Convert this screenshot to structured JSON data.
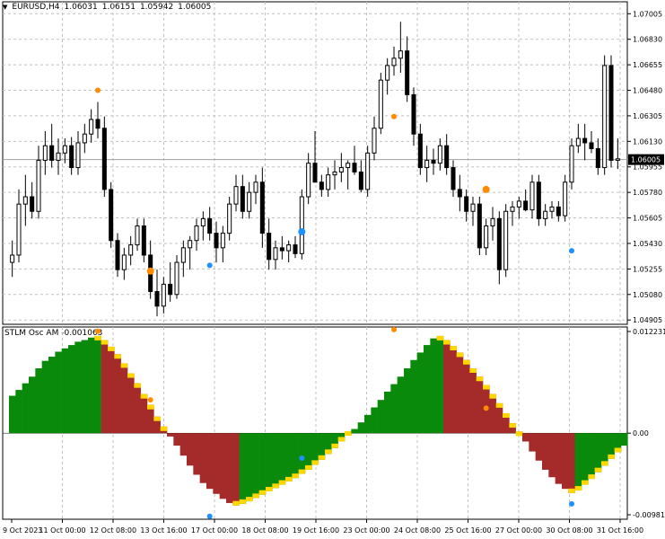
{
  "main_chart": {
    "symbol": "EURUSD,H4",
    "ohlc": [
      "1.06031",
      "1.06151",
      "1.05942",
      "1.06005"
    ],
    "price_labels": [
      "1.07005",
      "1.06830",
      "1.06655",
      "1.06480",
      "1.06305",
      "1.06130",
      "1.05955",
      "1.05780",
      "1.05605",
      "1.05430",
      "1.05255",
      "1.05080",
      "1.04905"
    ],
    "current_price_label": "1.06005"
  },
  "oscillator": {
    "title": "STLM Osc AM -0.001063",
    "labels": [
      "0.012231",
      "0.00",
      "-0.009811"
    ]
  },
  "time_labels": [
    "9 Oct 2023",
    "11 Oct 00:00",
    "12 Oct 08:00",
    "13 Oct 16:00",
    "17 Oct 00:00",
    "18 Oct 08:00",
    "19 Oct 16:00",
    "23 Oct 00:00",
    "24 Oct 08:00",
    "25 Oct 16:00",
    "27 Oct 00:00",
    "30 Oct 08:00",
    "31 Oct 16:00"
  ],
  "colors": {
    "bull_bar": "#0a8a0a",
    "bear_bar": "#a52a2a",
    "signal_bar": "#ffd700",
    "dot_orange": "#ff8c00",
    "dot_blue": "#1e90ff",
    "grid": "#c0c0c0"
  },
  "chart_data": [
    {
      "type": "candlestick",
      "title": "EURUSD,H4",
      "ylim": [
        1.049,
        1.0705
      ],
      "candles": [
        {
          "o": 1.053,
          "h": 1.0545,
          "l": 1.052,
          "c": 1.0535
        },
        {
          "o": 1.0535,
          "h": 1.058,
          "l": 1.053,
          "c": 1.057
        },
        {
          "o": 1.057,
          "h": 1.059,
          "l": 1.0555,
          "c": 1.0575
        },
        {
          "o": 1.0575,
          "h": 1.0585,
          "l": 1.056,
          "c": 1.0565
        },
        {
          "o": 1.0565,
          "h": 1.061,
          "l": 1.056,
          "c": 1.06
        },
        {
          "o": 1.06,
          "h": 1.062,
          "l": 1.059,
          "c": 1.061
        },
        {
          "o": 1.061,
          "h": 1.0625,
          "l": 1.0595,
          "c": 1.06
        },
        {
          "o": 1.06,
          "h": 1.0615,
          "l": 1.059,
          "c": 1.0605
        },
        {
          "o": 1.0605,
          "h": 1.0615,
          "l": 1.0598,
          "c": 1.061
        },
        {
          "o": 1.061,
          "h": 1.0616,
          "l": 1.059,
          "c": 1.0595
        },
        {
          "o": 1.0595,
          "h": 1.062,
          "l": 1.059,
          "c": 1.0612
        },
        {
          "o": 1.0612,
          "h": 1.0625,
          "l": 1.0605,
          "c": 1.0618
        },
        {
          "o": 1.0618,
          "h": 1.0635,
          "l": 1.0612,
          "c": 1.0628
        },
        {
          "o": 1.0628,
          "h": 1.064,
          "l": 1.0615,
          "c": 1.0622
        },
        {
          "o": 1.0622,
          "h": 1.063,
          "l": 1.0575,
          "c": 1.058
        },
        {
          "o": 1.058,
          "h": 1.0585,
          "l": 1.054,
          "c": 1.0545
        },
        {
          "o": 1.0545,
          "h": 1.055,
          "l": 1.052,
          "c": 1.0525
        },
        {
          "o": 1.0525,
          "h": 1.054,
          "l": 1.0518,
          "c": 1.0535
        },
        {
          "o": 1.0535,
          "h": 1.0548,
          "l": 1.0528,
          "c": 1.0542
        },
        {
          "o": 1.0542,
          "h": 1.056,
          "l": 1.0538,
          "c": 1.0555
        },
        {
          "o": 1.0555,
          "h": 1.056,
          "l": 1.053,
          "c": 1.0535
        },
        {
          "o": 1.0535,
          "h": 1.0545,
          "l": 1.0505,
          "c": 1.051
        },
        {
          "o": 1.051,
          "h": 1.0525,
          "l": 1.0493,
          "c": 1.05
        },
        {
          "o": 1.05,
          "h": 1.052,
          "l": 1.0495,
          "c": 1.0515
        },
        {
          "o": 1.0515,
          "h": 1.053,
          "l": 1.0503,
          "c": 1.0508
        },
        {
          "o": 1.0508,
          "h": 1.0535,
          "l": 1.0505,
          "c": 1.053
        },
        {
          "o": 1.053,
          "h": 1.0545,
          "l": 1.052,
          "c": 1.054
        },
        {
          "o": 1.054,
          "h": 1.0548,
          "l": 1.0525,
          "c": 1.0545
        },
        {
          "o": 1.0545,
          "h": 1.056,
          "l": 1.0538,
          "c": 1.0555
        },
        {
          "o": 1.0555,
          "h": 1.0565,
          "l": 1.0545,
          "c": 1.056
        },
        {
          "o": 1.056,
          "h": 1.0568,
          "l": 1.0545,
          "c": 1.055
        },
        {
          "o": 1.055,
          "h": 1.0558,
          "l": 1.053,
          "c": 1.054
        },
        {
          "o": 1.054,
          "h": 1.0555,
          "l": 1.053,
          "c": 1.055
        },
        {
          "o": 1.055,
          "h": 1.0575,
          "l": 1.0545,
          "c": 1.057
        },
        {
          "o": 1.057,
          "h": 1.059,
          "l": 1.0565,
          "c": 1.0582
        },
        {
          "o": 1.0582,
          "h": 1.059,
          "l": 1.056,
          "c": 1.0565
        },
        {
          "o": 1.0565,
          "h": 1.0585,
          "l": 1.056,
          "c": 1.0578
        },
        {
          "o": 1.0578,
          "h": 1.059,
          "l": 1.057,
          "c": 1.0585
        },
        {
          "o": 1.0585,
          "h": 1.0595,
          "l": 1.054,
          "c": 1.055
        },
        {
          "o": 1.055,
          "h": 1.056,
          "l": 1.0525,
          "c": 1.0532
        },
        {
          "o": 1.0532,
          "h": 1.0545,
          "l": 1.0525,
          "c": 1.054
        },
        {
          "o": 1.054,
          "h": 1.0548,
          "l": 1.0532,
          "c": 1.0538
        },
        {
          "o": 1.0538,
          "h": 1.0545,
          "l": 1.053,
          "c": 1.0542
        },
        {
          "o": 1.0542,
          "h": 1.0548,
          "l": 1.0533,
          "c": 1.0536
        },
        {
          "o": 1.0536,
          "h": 1.058,
          "l": 1.0532,
          "c": 1.0575
        },
        {
          "o": 1.0575,
          "h": 1.0605,
          "l": 1.057,
          "c": 1.0598
        },
        {
          "o": 1.0598,
          "h": 1.062,
          "l": 1.059,
          "c": 1.0585
        },
        {
          "o": 1.0585,
          "h": 1.059,
          "l": 1.0575,
          "c": 1.058
        },
        {
          "o": 1.058,
          "h": 1.0595,
          "l": 1.0575,
          "c": 1.059
        },
        {
          "o": 1.059,
          "h": 1.06,
          "l": 1.058,
          "c": 1.0592
        },
        {
          "o": 1.0592,
          "h": 1.0605,
          "l": 1.0585,
          "c": 1.0595
        },
        {
          "o": 1.0595,
          "h": 1.06,
          "l": 1.058,
          "c": 1.0598
        },
        {
          "o": 1.0598,
          "h": 1.061,
          "l": 1.059,
          "c": 1.0592
        },
        {
          "o": 1.0592,
          "h": 1.06,
          "l": 1.0578,
          "c": 1.058
        },
        {
          "o": 1.058,
          "h": 1.061,
          "l": 1.0575,
          "c": 1.0605
        },
        {
          "o": 1.0605,
          "h": 1.063,
          "l": 1.06,
          "c": 1.0622
        },
        {
          "o": 1.0622,
          "h": 1.066,
          "l": 1.0618,
          "c": 1.0655
        },
        {
          "o": 1.0655,
          "h": 1.067,
          "l": 1.0645,
          "c": 1.0665
        },
        {
          "o": 1.0665,
          "h": 1.0678,
          "l": 1.0658,
          "c": 1.067
        },
        {
          "o": 1.067,
          "h": 1.0695,
          "l": 1.066,
          "c": 1.0675
        },
        {
          "o": 1.0675,
          "h": 1.0685,
          "l": 1.064,
          "c": 1.0645
        },
        {
          "o": 1.0645,
          "h": 1.065,
          "l": 1.061,
          "c": 1.0618
        },
        {
          "o": 1.0618,
          "h": 1.0625,
          "l": 1.059,
          "c": 1.0595
        },
        {
          "o": 1.0595,
          "h": 1.061,
          "l": 1.0585,
          "c": 1.06
        },
        {
          "o": 1.06,
          "h": 1.0608,
          "l": 1.059,
          "c": 1.0598
        },
        {
          "o": 1.0598,
          "h": 1.0615,
          "l": 1.0593,
          "c": 1.061
        },
        {
          "o": 1.061,
          "h": 1.0618,
          "l": 1.059,
          "c": 1.0595
        },
        {
          "o": 1.0595,
          "h": 1.06,
          "l": 1.0575,
          "c": 1.058
        },
        {
          "o": 1.058,
          "h": 1.059,
          "l": 1.0565,
          "c": 1.0575
        },
        {
          "o": 1.0575,
          "h": 1.058,
          "l": 1.0558,
          "c": 1.0565
        },
        {
          "o": 1.0565,
          "h": 1.0575,
          "l": 1.0555,
          "c": 1.057
        },
        {
          "o": 1.057,
          "h": 1.0575,
          "l": 1.0535,
          "c": 1.054
        },
        {
          "o": 1.054,
          "h": 1.056,
          "l": 1.0535,
          "c": 1.0555
        },
        {
          "o": 1.0555,
          "h": 1.0568,
          "l": 1.0545,
          "c": 1.056
        },
        {
          "o": 1.056,
          "h": 1.0565,
          "l": 1.0515,
          "c": 1.0525
        },
        {
          "o": 1.0525,
          "h": 1.057,
          "l": 1.052,
          "c": 1.0565
        },
        {
          "o": 1.0565,
          "h": 1.0572,
          "l": 1.0555,
          "c": 1.0568
        },
        {
          "o": 1.0568,
          "h": 1.0575,
          "l": 1.056,
          "c": 1.0572
        },
        {
          "o": 1.0572,
          "h": 1.058,
          "l": 1.0565,
          "c": 1.0566
        },
        {
          "o": 1.0566,
          "h": 1.059,
          "l": 1.056,
          "c": 1.0585
        },
        {
          "o": 1.0585,
          "h": 1.059,
          "l": 1.0555,
          "c": 1.056
        },
        {
          "o": 1.056,
          "h": 1.057,
          "l": 1.0555,
          "c": 1.0565
        },
        {
          "o": 1.0565,
          "h": 1.0572,
          "l": 1.056,
          "c": 1.0568
        },
        {
          "o": 1.0568,
          "h": 1.0572,
          "l": 1.0558,
          "c": 1.0562
        },
        {
          "o": 1.0562,
          "h": 1.059,
          "l": 1.0558,
          "c": 1.0585
        },
        {
          "o": 1.0585,
          "h": 1.0615,
          "l": 1.058,
          "c": 1.061
        },
        {
          "o": 1.061,
          "h": 1.0625,
          "l": 1.0605,
          "c": 1.0615
        },
        {
          "o": 1.0615,
          "h": 1.0625,
          "l": 1.06,
          "c": 1.0612
        },
        {
          "o": 1.0612,
          "h": 1.062,
          "l": 1.0605,
          "c": 1.0608
        },
        {
          "o": 1.0608,
          "h": 1.0615,
          "l": 1.059,
          "c": 1.0595
        },
        {
          "o": 1.0595,
          "h": 1.0672,
          "l": 1.059,
          "c": 1.0665
        },
        {
          "o": 1.0665,
          "h": 1.0672,
          "l": 1.0595,
          "c": 1.06
        },
        {
          "o": 1.06,
          "h": 1.0615,
          "l": 1.0594,
          "c": 1.0601
        }
      ]
    },
    {
      "type": "bar",
      "title": "STLM Osc AM -0.001063",
      "ylim": [
        -0.009811,
        0.012231
      ],
      "values": [
        0.0045,
        0.0052,
        0.006,
        0.0068,
        0.0078,
        0.0087,
        0.0092,
        0.0098,
        0.0102,
        0.0106,
        0.011,
        0.0112,
        0.0115,
        0.0117,
        0.0112,
        0.0104,
        0.0095,
        0.0084,
        0.0072,
        0.006,
        0.0047,
        0.0034,
        0.002,
        0.0008,
        -0.0004,
        -0.0015,
        -0.0027,
        -0.0039,
        -0.005,
        -0.006,
        -0.0067,
        -0.0073,
        -0.0079,
        -0.0084,
        -0.0087,
        -0.0085,
        -0.0082,
        -0.0078,
        -0.0074,
        -0.007,
        -0.0066,
        -0.0062,
        -0.0058,
        -0.0054,
        -0.0049,
        -0.0044,
        -0.0038,
        -0.0032,
        -0.0025,
        -0.0018,
        -0.001,
        -0.0003,
        0.0005,
        0.0013,
        0.0022,
        0.0031,
        0.004,
        0.005,
        0.0059,
        0.0068,
        0.0078,
        0.0088,
        0.0097,
        0.0106,
        0.0114,
        0.0117,
        0.0112,
        0.0105,
        0.0097,
        0.0088,
        0.0078,
        0.0068,
        0.0058,
        0.0047,
        0.0036,
        0.0024,
        0.0012,
        0.0002,
        -0.001,
        -0.0022,
        -0.0033,
        -0.0044,
        -0.0053,
        -0.0061,
        -0.0067,
        -0.0072,
        -0.0069,
        -0.0062,
        -0.0055,
        -0.0047,
        -0.0039,
        -0.0031,
        -0.0023,
        -0.0015
      ]
    }
  ]
}
